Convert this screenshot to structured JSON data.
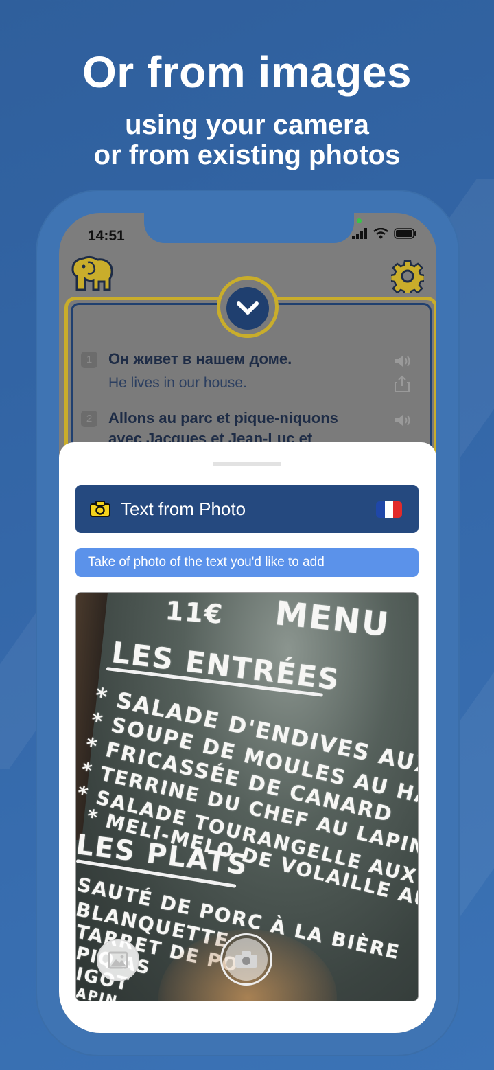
{
  "header": {
    "title": "Or from images",
    "subtitle_line1": "using your camera",
    "subtitle_line2": "or from existing photos"
  },
  "status_bar": {
    "time": "14:51"
  },
  "translations": [
    {
      "number": "1",
      "source": "Он живет в нашем доме.",
      "target": "He lives in our house."
    },
    {
      "number": "2",
      "source": "Allons au parc et pique-niquons",
      "target": "avec Jacques et Jean-Luc et"
    }
  ],
  "sheet": {
    "title": "Text from Photo",
    "hint": "Take of photo of the text you'd like to add",
    "flag_colors": [
      "#1f47a8",
      "#ffffff",
      "#e22b2b"
    ]
  },
  "photo_menu": {
    "lines": [
      "11€",
      "MENU",
      "LES ENTRÉES",
      "* SALADE D'ENDIVES AUX H",
      "* SOUPE DE MOULES AU HAD",
      "* FRICASSÉE DE CANARD",
      "* TERRINE DU CHEF AU LAPIN ET",
      "* SALADE TOURANGELLE AUX RI",
      "* MELI-MELO DE VOLAILLE AU B",
      "LES PLATS",
      "SAUTÉ DE PORC À LA BIÈRE",
      "BLANQUETTE",
      "TARRET DE PO",
      "PIQ    AS",
      "IGOT",
      "APIN"
    ]
  },
  "icons": {
    "logo": "elephant-icon",
    "settings": "gear-icon",
    "collapse": "chevron-down-icon",
    "speaker": "speaker-icon",
    "share": "share-icon",
    "camera": "camera-icon",
    "gallery": "gallery-icon",
    "shutter": "shutter-icon"
  },
  "colors": {
    "accent_gold": "#c9ad2b",
    "navy": "#25497f",
    "hint_blue": "#5b92ea"
  }
}
